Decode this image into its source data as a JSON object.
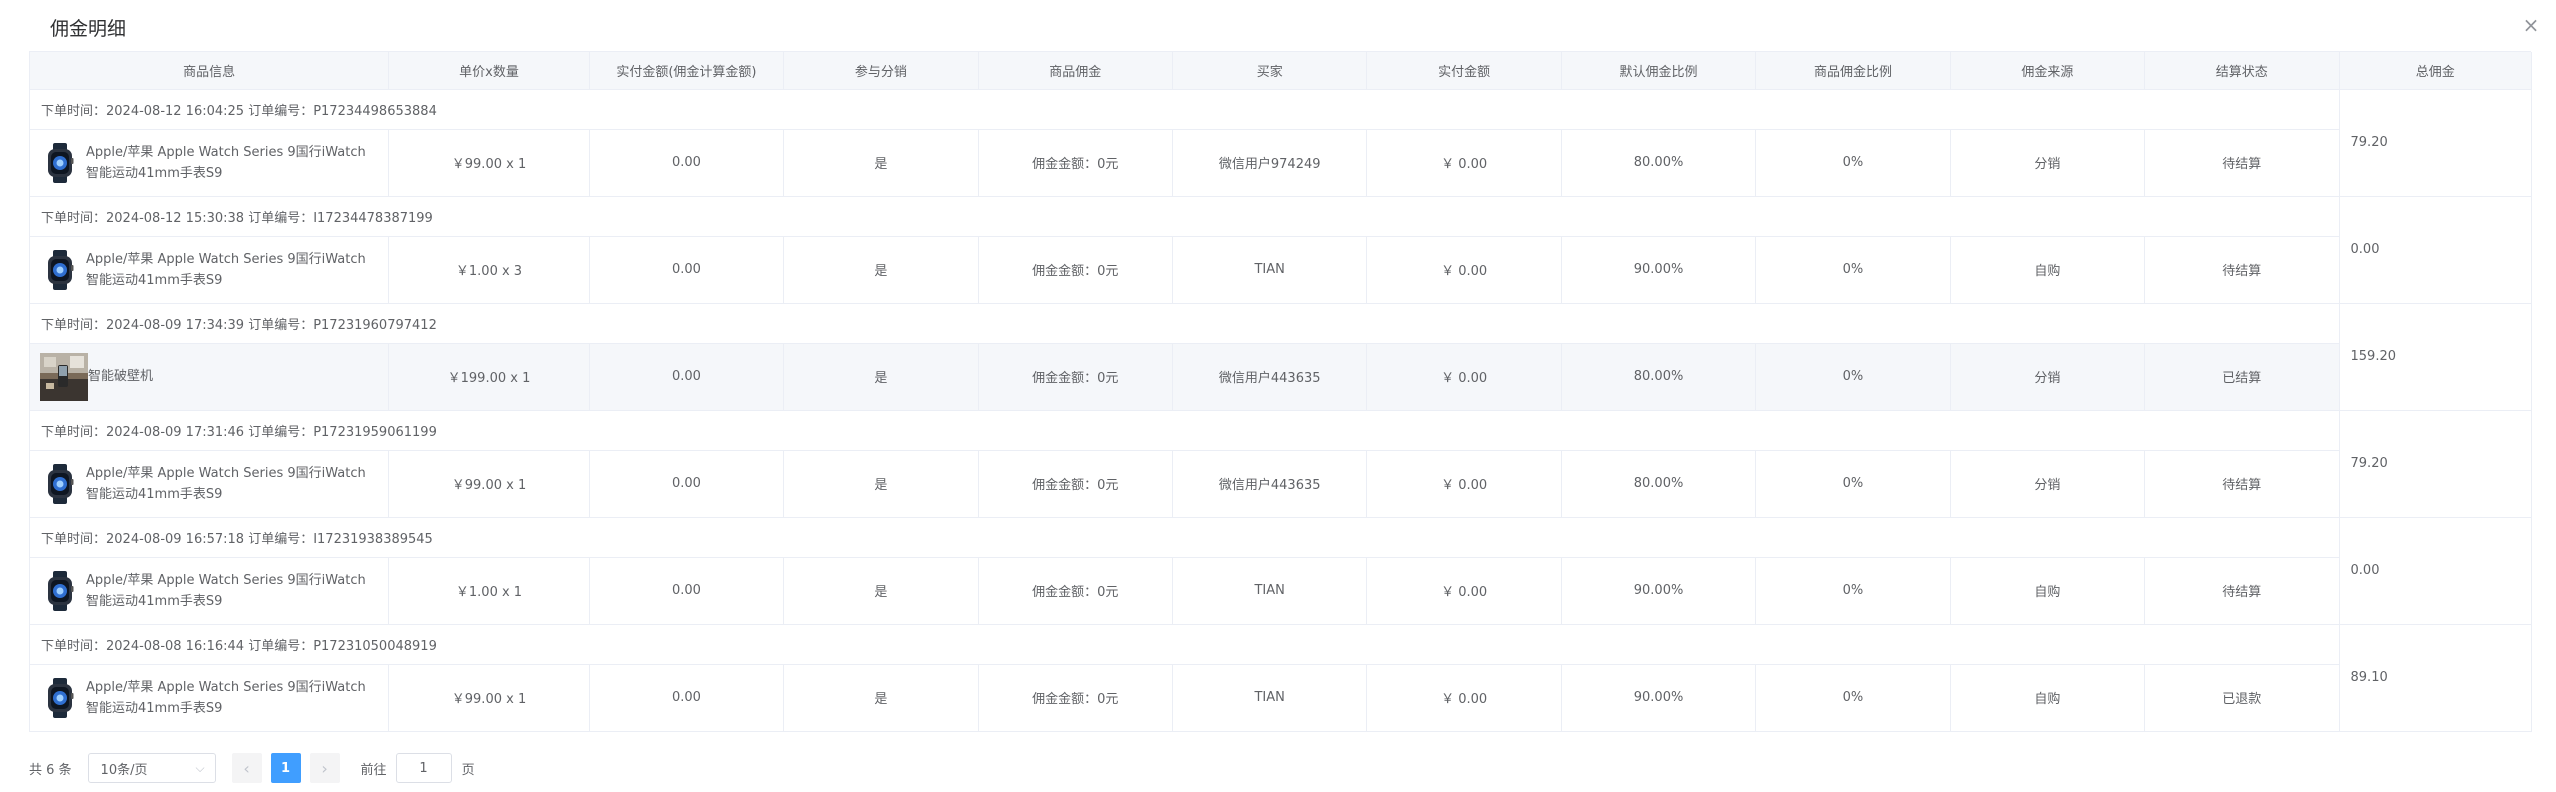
{
  "dialog": {
    "title": "佣金明细",
    "close_icon": "close-icon"
  },
  "table": {
    "columns": [
      "商品信息",
      "单价x数量",
      "实付金额(佣金计算金额)",
      "参与分销",
      "商品佣金",
      "买家",
      "实付金额",
      "默认佣金比例",
      "商品佣金比例",
      "佣金来源",
      "结算状态",
      "总佣金"
    ],
    "orders": [
      {
        "order_info": "下单时间：2024-08-12 16:04:25   订单编号：P17234498653884",
        "product": "Apple/苹果 Apple Watch Series 9国行iWatch智能运动41mm手表S9",
        "thumb_icon": "watch-icon",
        "price_qty": "￥99.00 x 1",
        "paid_calc": "0.00",
        "distribution": "是",
        "commission": "佣金金额：0元",
        "buyer": "微信用户974249",
        "paid": "￥ 0.00",
        "default_rate": "80.00%",
        "product_rate": "0%",
        "source": "分销",
        "status": "待结算",
        "total": "79.20"
      },
      {
        "order_info": "下单时间：2024-08-12 15:30:38   订单编号：I17234478387199",
        "product": "Apple/苹果 Apple Watch Series 9国行iWatch智能运动41mm手表S9",
        "thumb_icon": "watch-icon",
        "price_qty": "￥1.00 x 3",
        "paid_calc": "0.00",
        "distribution": "是",
        "commission": "佣金金额：0元",
        "buyer": "TIAN",
        "paid": "￥ 0.00",
        "default_rate": "90.00%",
        "product_rate": "0%",
        "source": "自购",
        "status": "待结算",
        "total": "0.00"
      },
      {
        "order_info": "下单时间：2024-08-09 17:34:39   订单编号：P17231960797412",
        "product": "智能破壁机",
        "thumb_icon": "kitchen-photo-icon",
        "price_qty": "￥199.00 x 1",
        "paid_calc": "0.00",
        "distribution": "是",
        "commission": "佣金金额：0元",
        "buyer": "微信用户443635",
        "paid": "￥ 0.00",
        "default_rate": "80.00%",
        "product_rate": "0%",
        "source": "分销",
        "status": "已结算",
        "total": "159.20"
      },
      {
        "order_info": "下单时间：2024-08-09 17:31:46   订单编号：P17231959061199",
        "product": "Apple/苹果 Apple Watch Series 9国行iWatch智能运动41mm手表S9",
        "thumb_icon": "watch-icon",
        "price_qty": "￥99.00 x 1",
        "paid_calc": "0.00",
        "distribution": "是",
        "commission": "佣金金额：0元",
        "buyer": "微信用户443635",
        "paid": "￥ 0.00",
        "default_rate": "80.00%",
        "product_rate": "0%",
        "source": "分销",
        "status": "待结算",
        "total": "79.20"
      },
      {
        "order_info": "下单时间：2024-08-09 16:57:18   订单编号：I17231938389545",
        "product": "Apple/苹果 Apple Watch Series 9国行iWatch智能运动41mm手表S9",
        "thumb_icon": "watch-icon",
        "price_qty": "￥1.00 x 1",
        "paid_calc": "0.00",
        "distribution": "是",
        "commission": "佣金金额：0元",
        "buyer": "TIAN",
        "paid": "￥ 0.00",
        "default_rate": "90.00%",
        "product_rate": "0%",
        "source": "自购",
        "status": "待结算",
        "total": "0.00"
      },
      {
        "order_info": "下单时间：2024-08-08 16:16:44   订单编号：P17231050048919",
        "product": "Apple/苹果 Apple Watch Series 9国行iWatch智能运动41mm手表S9",
        "thumb_icon": "watch-icon",
        "price_qty": "￥99.00 x 1",
        "paid_calc": "0.00",
        "distribution": "是",
        "commission": "佣金金额：0元",
        "buyer": "TIAN",
        "paid": "￥ 0.00",
        "default_rate": "90.00%",
        "product_rate": "0%",
        "source": "自购",
        "status": "已退款",
        "total": "89.10"
      }
    ]
  },
  "pagination": {
    "total_text": "共 6 条",
    "page_size": "10条/页",
    "current_page": "1",
    "goto_label": "前往",
    "goto_value": "1",
    "page_unit": "页"
  },
  "colors": {
    "accent": "#409eff",
    "header_bg": "#f5f7fa",
    "border": "#ebeef5"
  }
}
